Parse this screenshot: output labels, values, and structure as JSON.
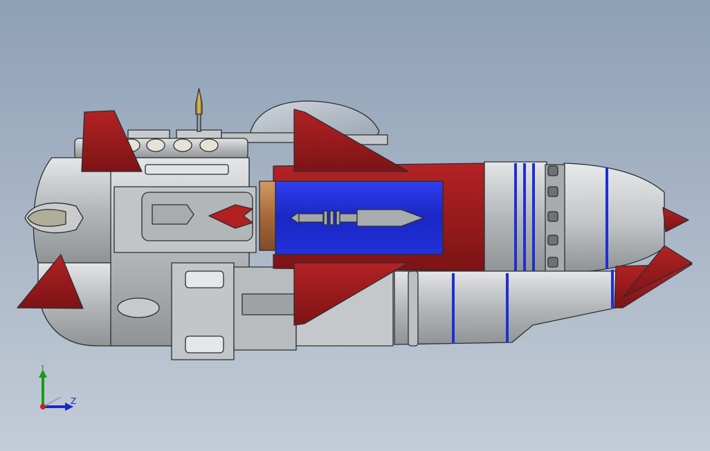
{
  "viewport": {
    "background_top": "#8ea0b6",
    "background_bottom": "#c3ccd7"
  },
  "model": {
    "colors": {
      "body_gray": "#b7babd",
      "body_light": "#d8dadb",
      "fin_red": "#9b1b1d",
      "cutaway_blue": "#1f2fd1",
      "copper": "#b0743e",
      "outline": "#2b2e30"
    }
  },
  "triad": {
    "y_label": "Y",
    "z_label": "Z",
    "y_color": "#1a9a1a",
    "z_color": "#1a28c8",
    "origin_color": "#cc1e1e"
  }
}
